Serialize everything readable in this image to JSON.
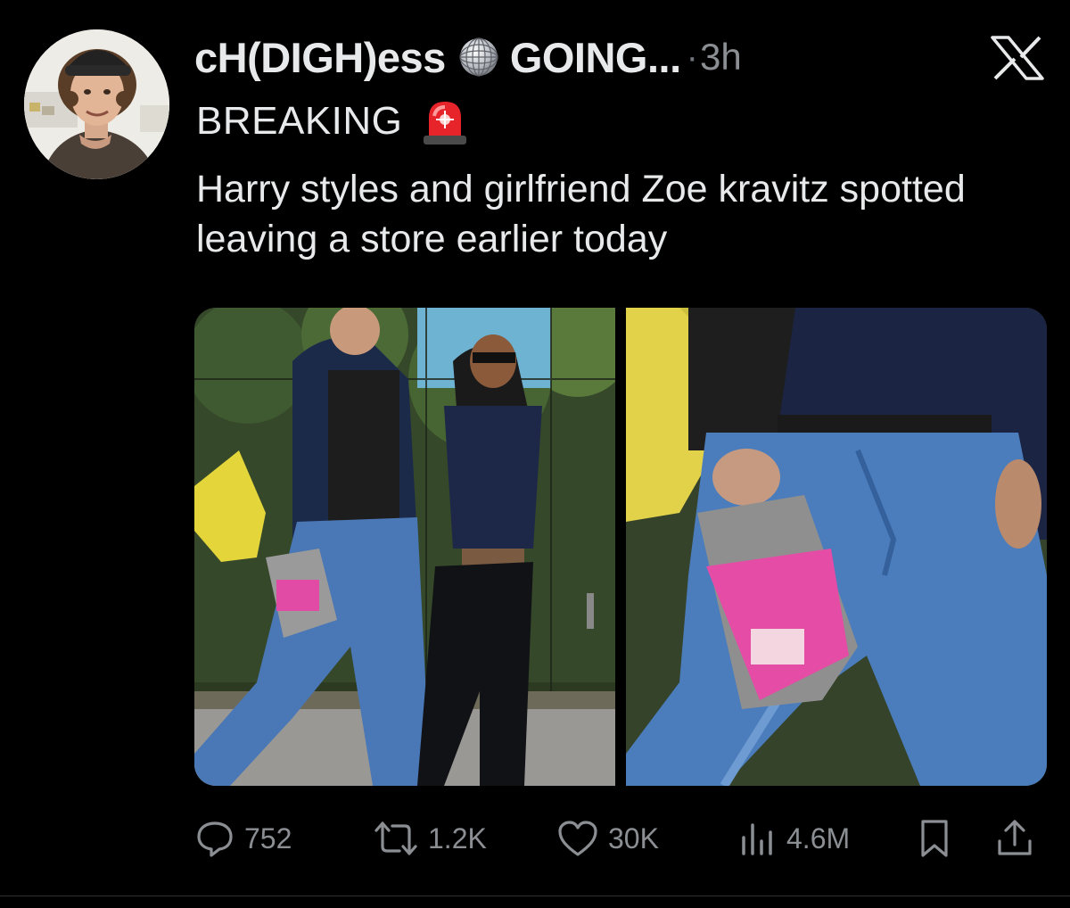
{
  "tweet": {
    "display_name": "cH(DIGH)ess",
    "display_name_suffix": "GOING...",
    "separator": "·",
    "timestamp": "3h",
    "line1": "BREAKING",
    "body": "Harry styles and girlfriend Zoe kravitz spotted leaving a store earlier today"
  },
  "icons": {
    "name_emoji": "disco-ball-icon",
    "breaking_emoji": "police-siren-icon",
    "platform": "x-logo-icon"
  },
  "metrics": {
    "replies": "752",
    "retweets": "1.2K",
    "likes": "30K",
    "views": "4.6M"
  },
  "colors": {
    "background": "#000000",
    "text": "#e7e9ea",
    "muted": "#8b8f94"
  }
}
